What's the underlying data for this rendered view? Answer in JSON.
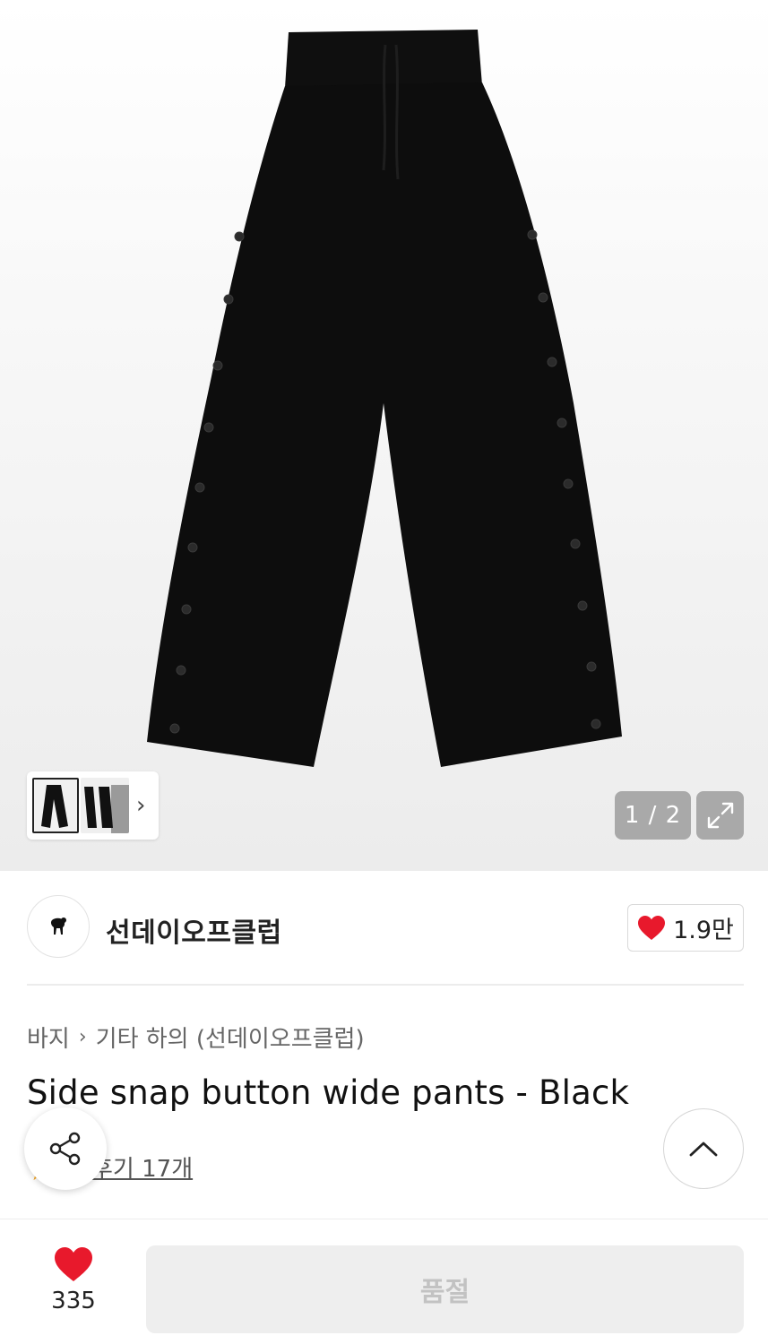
{
  "gallery": {
    "counter": "1 / 2",
    "current_index": 1,
    "total": 2,
    "icons": {
      "expand": "expand-arrows-icon",
      "next": "chevron-right-icon"
    }
  },
  "brand": {
    "name": "선데이오프클럽",
    "logo_icon": "lamb-icon",
    "likes": "1.9만"
  },
  "breadcrumb": {
    "category": "바지",
    "subcategory": "기타 하의 (선데이오프클럽)"
  },
  "product": {
    "title": "Side snap button wide pants - Black",
    "reviews_label": "후기 17개"
  },
  "bottom_bar": {
    "wish_count": "335",
    "soldout_label": "품절"
  },
  "colors": {
    "heart": "#e8192c",
    "pants": "#0d0d0d",
    "button_disabled_bg": "#eeeeee",
    "button_disabled_text": "#c2c2c2"
  }
}
